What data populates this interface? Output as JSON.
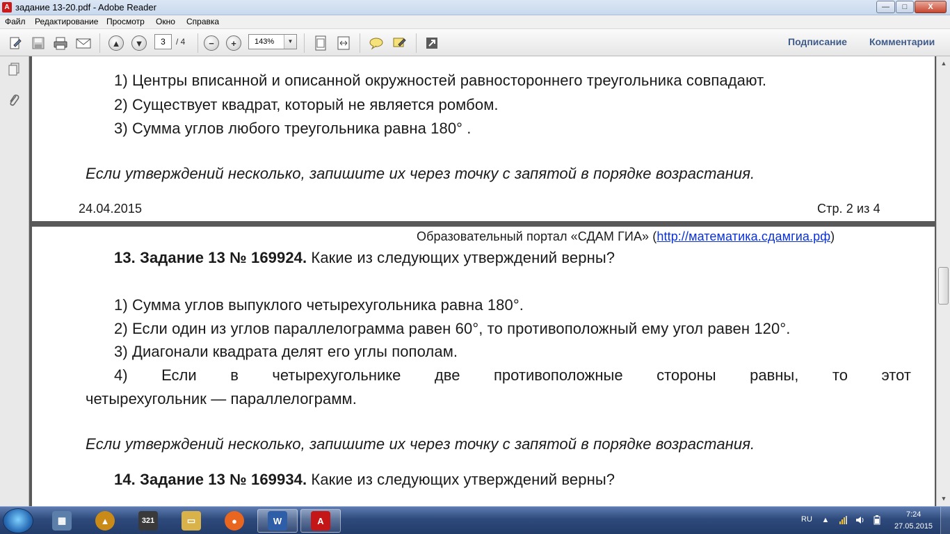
{
  "window": {
    "title": "задание 13-20.pdf - Adobe Reader",
    "app_icon_glyph": "A",
    "controls": {
      "minimize": "—",
      "maximize": "□",
      "close": "X"
    }
  },
  "menu": [
    "Файл",
    "Редактирование",
    "Просмотр",
    "Окно",
    "Справка"
  ],
  "toolbar": {
    "current_page": "3",
    "page_total": "/ 4",
    "zoom": "143%",
    "zoom_drop": "▼",
    "right_links": [
      "Подписание",
      "Комментарии"
    ]
  },
  "page2": {
    "statements": [
      "1) Центры вписанной и описанной окружностей равностороннего треугольника совпадают.",
      "2) Существует квадрат, который не является ромбом.",
      "3) Сумма углов любого треугольника равна 180° ."
    ],
    "instruction": "Если утверждений несколько, запишите их через точку с запятой в порядке возрастания.",
    "footer_date": "24.04.2015",
    "footer_page": "Стр. 2 из 4"
  },
  "page3": {
    "header_text": "Образовательный портал «СДАМ ГИА» (",
    "header_link": "http://математика.сдамгиа.рф",
    "header_close": ")",
    "task13": {
      "heading": "13. Задание 13 № 169924.",
      "question": " Какие из следующих утверждений верны?",
      "statements": [
        "1) Сумма углов выпуклого четырехугольника равна 180°.",
        "2) Если один из углов параллелограмма равен 60°, то противоположный ему угол равен 120°.",
        "3) Диагонали квадрата делят его углы пополам."
      ],
      "statement4_words": [
        "4)",
        "Если",
        "в",
        "четырехугольнике",
        "две",
        "противоположные",
        "стороны",
        "равны,",
        "то",
        "этот"
      ],
      "statement4_cont": "четырехугольник — параллелограмм.",
      "instruction": "Если утверждений несколько, запишите их через точку с запятой в порядке возрастания."
    },
    "task14": {
      "heading": "14. Задание 13 № 169934.",
      "question": " Какие из следующих утверждений верны?"
    }
  },
  "taskbar": {
    "apps": [
      {
        "name": "calculator",
        "glyph": "▦",
        "color": "#5b7fa8"
      },
      {
        "name": "archicad",
        "glyph": "▲",
        "color": "#c98a17"
      },
      {
        "name": "media-player-321",
        "glyph": "321",
        "color": "#3a3a3a"
      },
      {
        "name": "file-explorer",
        "glyph": "▭",
        "color": "#d9b24a"
      },
      {
        "name": "firefox",
        "glyph": "●",
        "color": "#e8661f"
      },
      {
        "name": "word",
        "glyph": "W",
        "color": "#2f5ea8"
      },
      {
        "name": "adobe-reader",
        "glyph": "A",
        "color": "#c41616"
      }
    ],
    "language": "RU",
    "time": "7:24",
    "date": "27.05.2015"
  }
}
